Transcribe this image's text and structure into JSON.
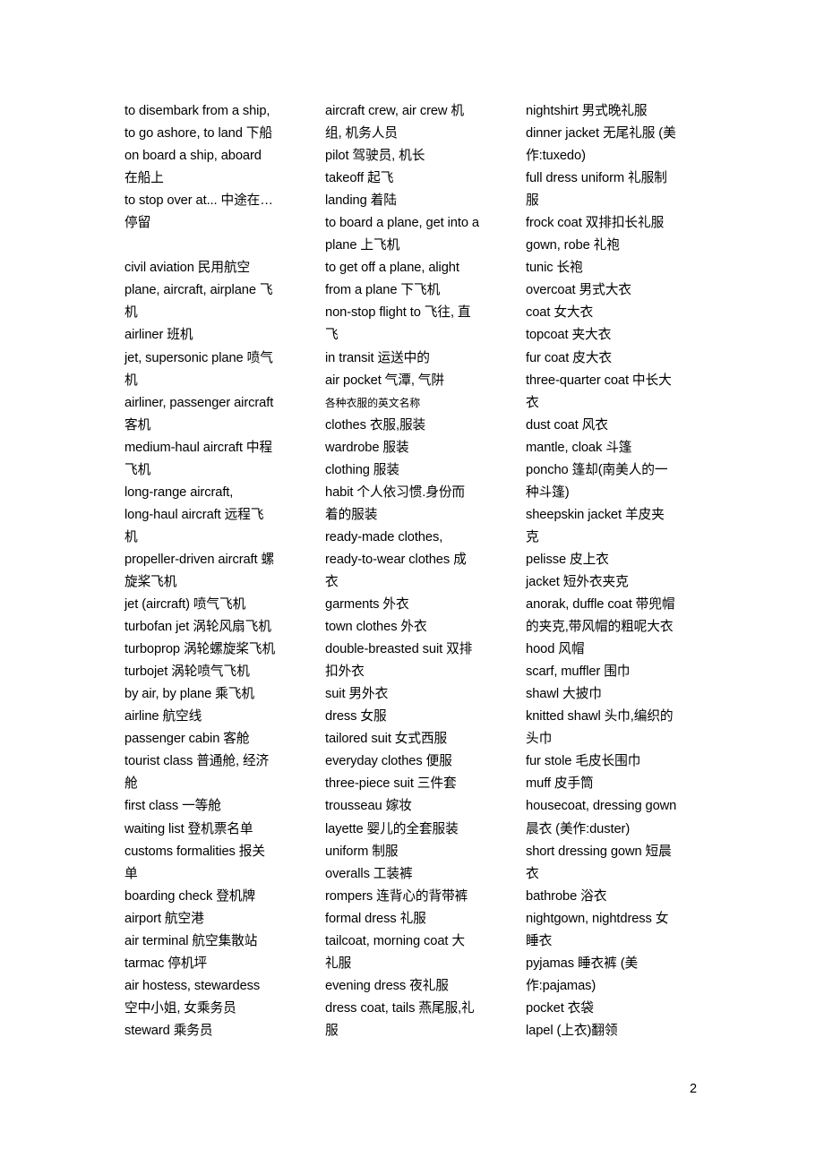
{
  "document": {
    "page_number": "2",
    "columns": [
      {
        "id": "column-1",
        "entries": [
          "to disembark from a ship,",
          "to go ashore, to land   下船",
          "on board a ship, aboard",
          "在船上",
          "to stop over at...   中途在…",
          "停留",
          "",
          "civil aviation   民用航空",
          "plane, aircraft, airplane   飞",
          "机",
          "airliner   班机",
          "jet, supersonic plane   喷气",
          "机",
          "airliner, passenger aircraft",
          "客机",
          "medium-haul aircraft   中程",
          "飞机",
          "long-range aircraft,",
          "long-haul aircraft   远程飞",
          "机",
          "propeller-driven aircraft   螺",
          "旋桨飞机",
          "jet (aircraft)   喷气飞机",
          "turbofan jet   涡轮风扇飞机",
          "turboprop   涡轮螺旋桨飞机",
          "turbojet   涡轮喷气飞机",
          "by air, by plane   乘飞机",
          "airline   航空线",
          "passenger cabin   客舱",
          "tourist class   普通舱, 经济",
          "舱",
          "first class   一等舱",
          "waiting list   登机票名单",
          "customs formalities   报关",
          "单",
          "boarding check   登机牌",
          "airport   航空港",
          "air terminal   航空集散站",
          "tarmac   停机坪",
          "air hostess, stewardess",
          "空中小姐, 女乘务员",
          "steward   乘务员"
        ]
      },
      {
        "id": "column-2",
        "entries": [
          "aircraft crew, air crew   机",
          "组, 机务人员",
          "pilot   驾驶员, 机长",
          "takeoff   起飞",
          "landing   着陆",
          "to board a plane, get into a",
          "plane   上飞机",
          "to get off a plane, alight",
          "from a plane   下飞机",
          "non-stop flight to   飞往, 直",
          "飞",
          "in transit   运送中的",
          "air pocket   气潭, 气阱",
          "各种衣服的英文名称",
          "clothes   衣服,服装",
          "wardrobe   服装",
          "clothing   服装",
          "habit   个人依习惯.身份而",
          "着的服装",
          "ready-made clothes,",
          "ready-to-wear clothes   成",
          "衣",
          "garments   外衣",
          "town clothes   外衣",
          "double-breasted suit   双排",
          "扣外衣",
          "suit   男外衣",
          "dress   女服",
          "tailored suit   女式西服",
          "everyday clothes   便服",
          "three-piece suit   三件套",
          "trousseau   嫁妆",
          "layette   婴儿的全套服装",
          "uniform   制服",
          "overalls   工装裤",
          "rompers   连背心的背带裤",
          "formal dress   礼服",
          "tailcoat, morning coat   大",
          "礼服",
          "evening dress   夜礼服",
          "dress coat, tails   燕尾服,礼",
          "服"
        ],
        "small_header_index": 13
      },
      {
        "id": "column-3",
        "entries": [
          "nightshirt   男式晚礼服",
          "dinner jacket   无尾礼服 (美",
          "作:tuxedo)",
          "full dress uniform   礼服制",
          "服",
          "frock coat   双排扣长礼服",
          "gown, robe   礼袍",
          "tunic   长袍",
          "overcoat   男式大衣",
          "coat   女大衣",
          "topcoat   夹大衣",
          "fur coat   皮大衣",
          "three-quarter coat   中长大",
          "衣",
          "dust coat   风衣",
          "mantle, cloak   斗篷",
          "poncho   篷却(南美人的一",
          "种斗篷)",
          "sheepskin jacket   羊皮夹",
          "克",
          "pelisse   皮上衣",
          "jacket   短外衣夹克",
          "anorak, duffle coat   带兜帽",
          "的夹克,带风帽的粗呢大衣",
          "hood   风帽",
          "scarf, muffler   围巾",
          "shawl   大披巾",
          "knitted shawl   头巾,编织的",
          "头巾",
          "fur stole   毛皮长围巾",
          "muff   皮手筒",
          "housecoat, dressing gown",
          "晨衣 (美作:duster)",
          "short dressing gown   短晨",
          "衣",
          "bathrobe   浴衣",
          "nightgown, nightdress   女",
          "睡衣",
          "pyjamas   睡衣裤 (美",
          "作:pajamas)",
          "pocket   衣袋",
          "lapel   (上衣)翻领"
        ]
      }
    ]
  }
}
